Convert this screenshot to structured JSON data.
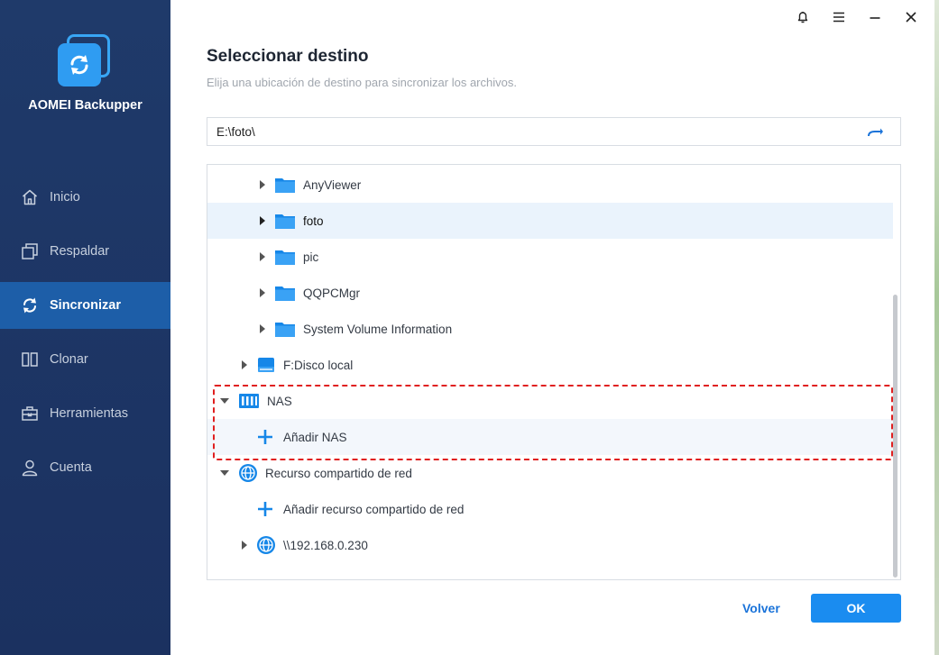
{
  "app": {
    "name": "AOMEI Backupper"
  },
  "sidebar": {
    "items": [
      {
        "label": "Inicio",
        "icon": "home-icon",
        "active": false
      },
      {
        "label": "Respaldar",
        "icon": "backup-icon",
        "active": false
      },
      {
        "label": "Sincronizar",
        "icon": "sync-icon",
        "active": true
      },
      {
        "label": "Clonar",
        "icon": "clone-icon",
        "active": false
      },
      {
        "label": "Herramientas",
        "icon": "toolbox-icon",
        "active": false
      },
      {
        "label": "Cuenta",
        "icon": "user-icon",
        "active": false
      }
    ]
  },
  "window": {
    "controls": [
      "bell-icon",
      "menu-icon",
      "minimize-icon",
      "close-icon"
    ]
  },
  "dialog": {
    "title": "Seleccionar destino",
    "subtitle": "Elija una ubicación de destino para sincronizar los archivos.",
    "path_value": "E:\\foto\\",
    "tree": [
      {
        "label": "AnyViewer",
        "icon": "folder-icon",
        "expanded": false,
        "selected": false
      },
      {
        "label": "foto",
        "icon": "folder-icon",
        "expanded": false,
        "selected": true
      },
      {
        "label": "pic",
        "icon": "folder-icon",
        "expanded": false,
        "selected": false
      },
      {
        "label": "QQPCMgr",
        "icon": "folder-icon",
        "expanded": false,
        "selected": false
      },
      {
        "label": "System Volume Information",
        "icon": "folder-icon",
        "expanded": false,
        "selected": false
      },
      {
        "label": "F:Disco local",
        "icon": "drive-icon",
        "expanded": false,
        "selected": false
      },
      {
        "label": "NAS",
        "icon": "nas-icon",
        "expanded": true,
        "selected": false
      },
      {
        "label": "Añadir NAS",
        "icon": "plus-icon",
        "expanded": false,
        "selected": false
      },
      {
        "label": "Recurso compartido de red",
        "icon": "globe-icon",
        "expanded": true,
        "selected": false
      },
      {
        "label": "Añadir recurso compartido de red",
        "icon": "plus-icon",
        "expanded": false,
        "selected": false
      },
      {
        "label": "\\\\192.168.0.230",
        "icon": "globe-icon",
        "expanded": false,
        "selected": false
      }
    ],
    "back_label": "Volver",
    "ok_label": "OK"
  },
  "colors": {
    "sidebar_bg": "#1f3a6a",
    "sidebar_active": "#1d5ea8",
    "accent": "#1a8cf0",
    "highlight_border": "#e02020"
  }
}
